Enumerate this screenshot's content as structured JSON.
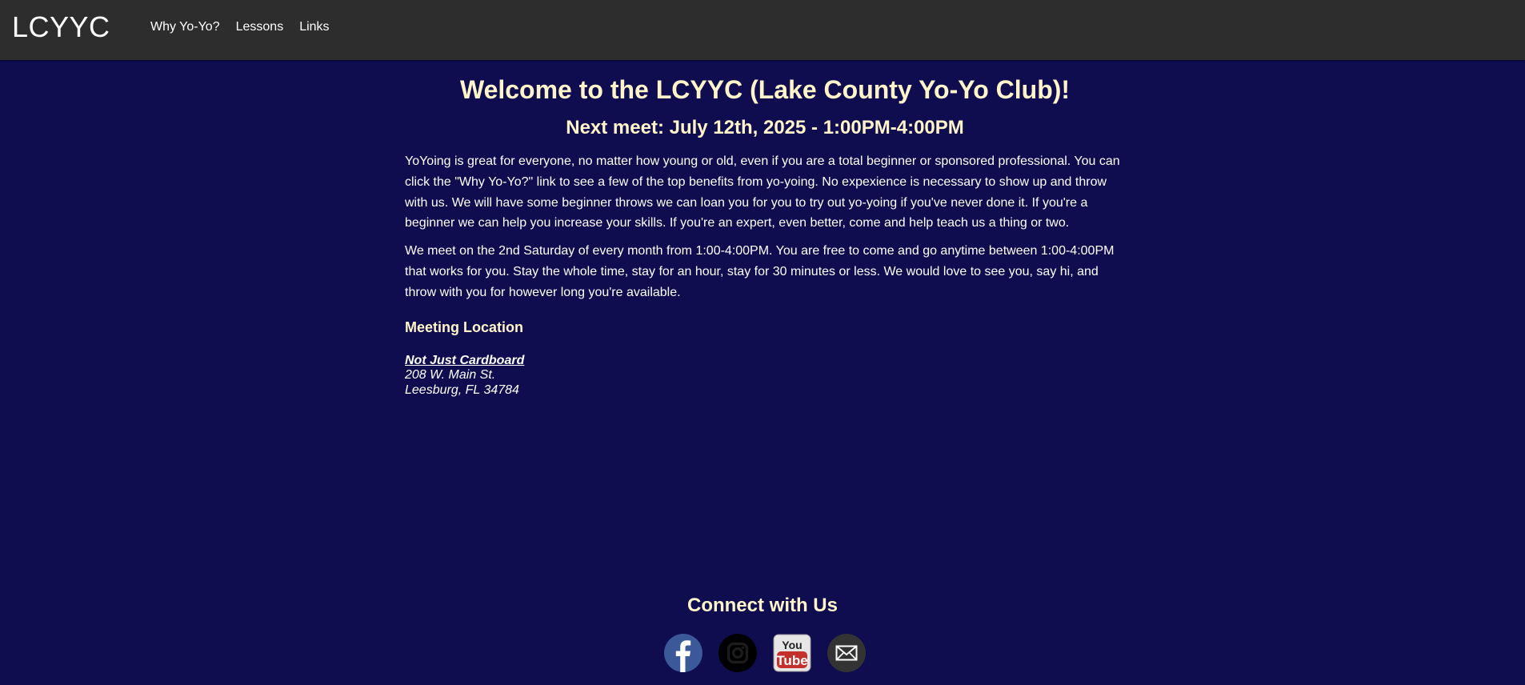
{
  "header": {
    "logo": "LCYYC",
    "nav": [
      {
        "label": "Why Yo-Yo?"
      },
      {
        "label": "Lessons"
      },
      {
        "label": "Links"
      }
    ]
  },
  "main": {
    "title": "Welcome to the LCYYC (Lake County Yo-Yo Club)!",
    "next_meet": "Next meet: July 12th, 2025 - 1:00PM-4:00PM",
    "paragraphs": [
      "YoYoing is great for everyone, no matter how young or old, even if you are a total beginner or sponsored professional. You can click the \"Why Yo-Yo?\" link to see a few of the top benefits from yo-yoing. No expexience is necessary to show up and throw with us. We will have some beginner throws we can loan you for you to try out yo-yoing if you've never done it. If you're a beginner we can help you increase your skills. If you're an expert, even better, come and help teach us a thing or two.",
      "We meet on the 2nd Saturday of every month from 1:00-4:00PM. You are free to come and go anytime between 1:00-4:00PM that works for you. Stay the whole time, stay for an hour, stay for 30 minutes or less. We would love to see you, say hi, and throw with you for however long you're available."
    ],
    "location_heading": "Meeting Location",
    "venue_name": "Not Just Cardboard",
    "street": "208 W. Main St.",
    "city": "Leesburg, FL 34784"
  },
  "footer": {
    "heading": "Connect with Us",
    "social": [
      {
        "icon": "facebook-icon"
      },
      {
        "icon": "instagram-icon"
      },
      {
        "icon": "youtube-icon",
        "text_top": "You",
        "text_bottom": "Tube"
      },
      {
        "icon": "email-icon"
      }
    ]
  },
  "colors": {
    "background": "#0f0c4f",
    "topbar": "#2d2d2d",
    "heading": "#fff5c8",
    "facebook": "#3b5998",
    "youtube_red": "#c4302b"
  }
}
